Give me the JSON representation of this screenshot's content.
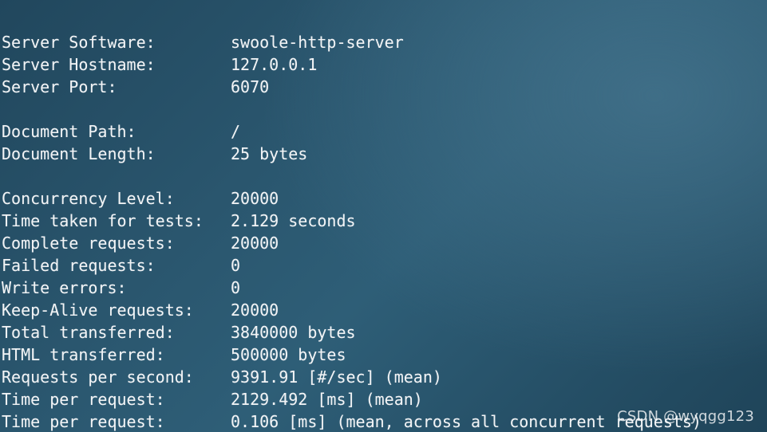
{
  "colors": {
    "background": "#2a566e",
    "text": "#f2f4f6"
  },
  "server": [
    {
      "label": "Server Software:",
      "value": "swoole-http-server"
    },
    {
      "label": "Server Hostname:",
      "value": "127.0.0.1"
    },
    {
      "label": "Server Port:",
      "value": "6070"
    }
  ],
  "document": [
    {
      "label": "Document Path:",
      "value": "/"
    },
    {
      "label": "Document Length:",
      "value": "25 bytes"
    }
  ],
  "results": [
    {
      "label": "Concurrency Level:",
      "value": "20000"
    },
    {
      "label": "Time taken for tests:",
      "value": "2.129 seconds"
    },
    {
      "label": "Complete requests:",
      "value": "20000"
    },
    {
      "label": "Failed requests:",
      "value": "0"
    },
    {
      "label": "Write errors:",
      "value": "0"
    },
    {
      "label": "Keep-Alive requests:",
      "value": "20000"
    },
    {
      "label": "Total transferred:",
      "value": "3840000 bytes"
    },
    {
      "label": "HTML transferred:",
      "value": "500000 bytes"
    },
    {
      "label": "Requests per second:",
      "value": "9391.91 [#/sec] (mean)"
    },
    {
      "label": "Time per request:",
      "value": "2129.492 [ms] (mean)"
    },
    {
      "label": "Time per request:",
      "value": "0.106 [ms] (mean, across all concurrent requests)"
    }
  ],
  "watermark": "CSDN @wyqgg123"
}
